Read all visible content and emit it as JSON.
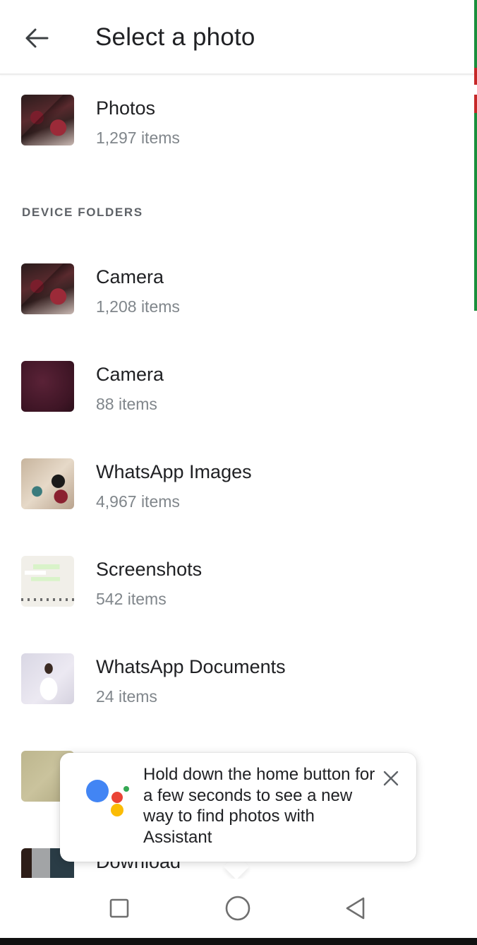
{
  "app_bar": {
    "title": "Select a photo"
  },
  "photos_item": {
    "title": "Photos",
    "count": "1,297 items"
  },
  "device_folders": {
    "header": "DEVICE FOLDERS",
    "items": [
      {
        "title": "Camera",
        "count": "1,208 items",
        "thumbnail": "camera-thumbnail-1"
      },
      {
        "title": "Camera",
        "count": "88 items",
        "thumbnail": "camera-thumbnail-2"
      },
      {
        "title": "WhatsApp Images",
        "count": "4,967 items",
        "thumbnail": "whatsapp-images-thumbnail"
      },
      {
        "title": "Screenshots",
        "count": "542 items",
        "thumbnail": "screenshots-thumbnail"
      },
      {
        "title": "WhatsApp Documents",
        "count": "24 items",
        "thumbnail": "whatsapp-documents-thumbnail"
      },
      {
        "title": "",
        "count": "",
        "thumbnail": "folder-thumbnail-olive"
      },
      {
        "title": "Download",
        "count": "",
        "thumbnail": "download-thumbnail"
      }
    ]
  },
  "assistant_tooltip": {
    "text": "Hold down the home button for a few seconds to see a new way to find photos with Assistant",
    "logo_colors": [
      "#4285F4",
      "#EA4335",
      "#FBBC05",
      "#34A853"
    ]
  },
  "icons": {
    "back": "arrow-left-icon",
    "close": "close-icon",
    "recents": "square-icon",
    "home": "circle-icon",
    "back_nav": "triangle-back-icon"
  },
  "colors": {
    "primary_text": "#202124",
    "secondary_text": "#80868b",
    "section_label": "#5f6368"
  }
}
